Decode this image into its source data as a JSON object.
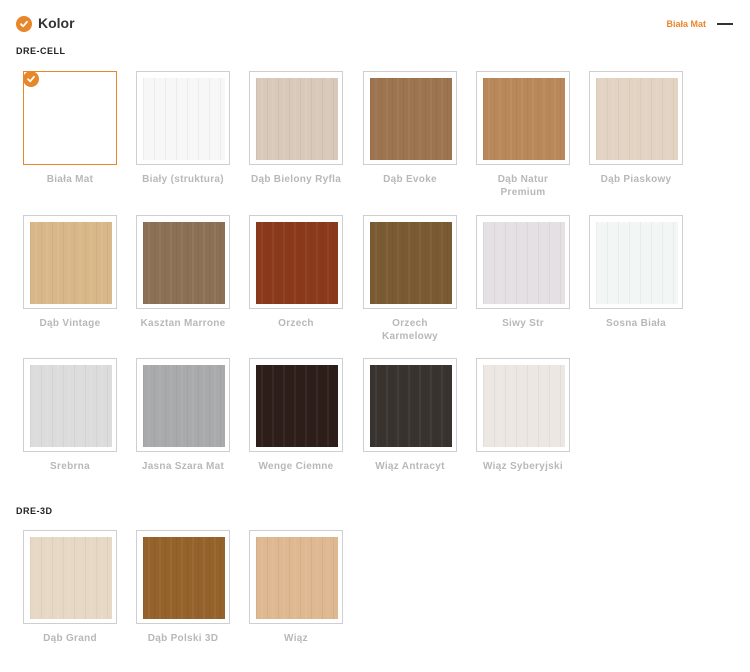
{
  "header": {
    "title": "Kolor",
    "selected_value": "Biała Mat"
  },
  "groups": [
    {
      "label": "DRE-CELL"
    },
    {
      "label": "DRE-3D"
    }
  ],
  "swatches": [
    {
      "label": "Biała Mat",
      "color": "#ffffff",
      "selected": true
    },
    {
      "label": "Biały (struktura)",
      "color": "#f7f7f7"
    },
    {
      "label": "Dąb Bielony Ryfla",
      "color": "#d9c9bb"
    },
    {
      "label": "Dąb Evoke",
      "color": "#9c7450"
    },
    {
      "label": "Dąb Natur Premium",
      "color": "#b8885a"
    },
    {
      "label": "Dąb Piaskowy",
      "color": "#e3d3c3"
    },
    {
      "label": "Dąb Vintage",
      "color": "#d8b888"
    },
    {
      "label": "Kasztan Marrone",
      "color": "#8c7055"
    },
    {
      "label": "Orzech",
      "color": "#8a3a1a"
    },
    {
      "label": "Orzech Karmelowy",
      "color": "#7a5a32"
    },
    {
      "label": "Siwy Str",
      "color": "#e4e0e4"
    },
    {
      "label": "Sosna Biała",
      "color": "#f2f6f4"
    },
    {
      "label": "Srebrna",
      "color": "#dcdcdc"
    },
    {
      "label": "Jasna Szara Mat",
      "color": "#a9aaab"
    },
    {
      "label": "Wenge Ciemne",
      "color": "#2e1e1a"
    },
    {
      "label": "Wiąz Antracyt",
      "color": "#38332e"
    },
    {
      "label": "Wiąz Syberyjski",
      "color": "#ece7e3"
    },
    {
      "label": "Dąb Grand",
      "color": "#e6d8c4"
    },
    {
      "label": "Dąb Polski 3D",
      "color": "#94622a"
    },
    {
      "label": "Wiąz",
      "color": "#deb890"
    }
  ],
  "colors": {
    "accent": "#e8862a",
    "label": "#b8b8b8"
  },
  "icons": {
    "check": "checkmark-icon",
    "collapse": "minus-icon"
  }
}
